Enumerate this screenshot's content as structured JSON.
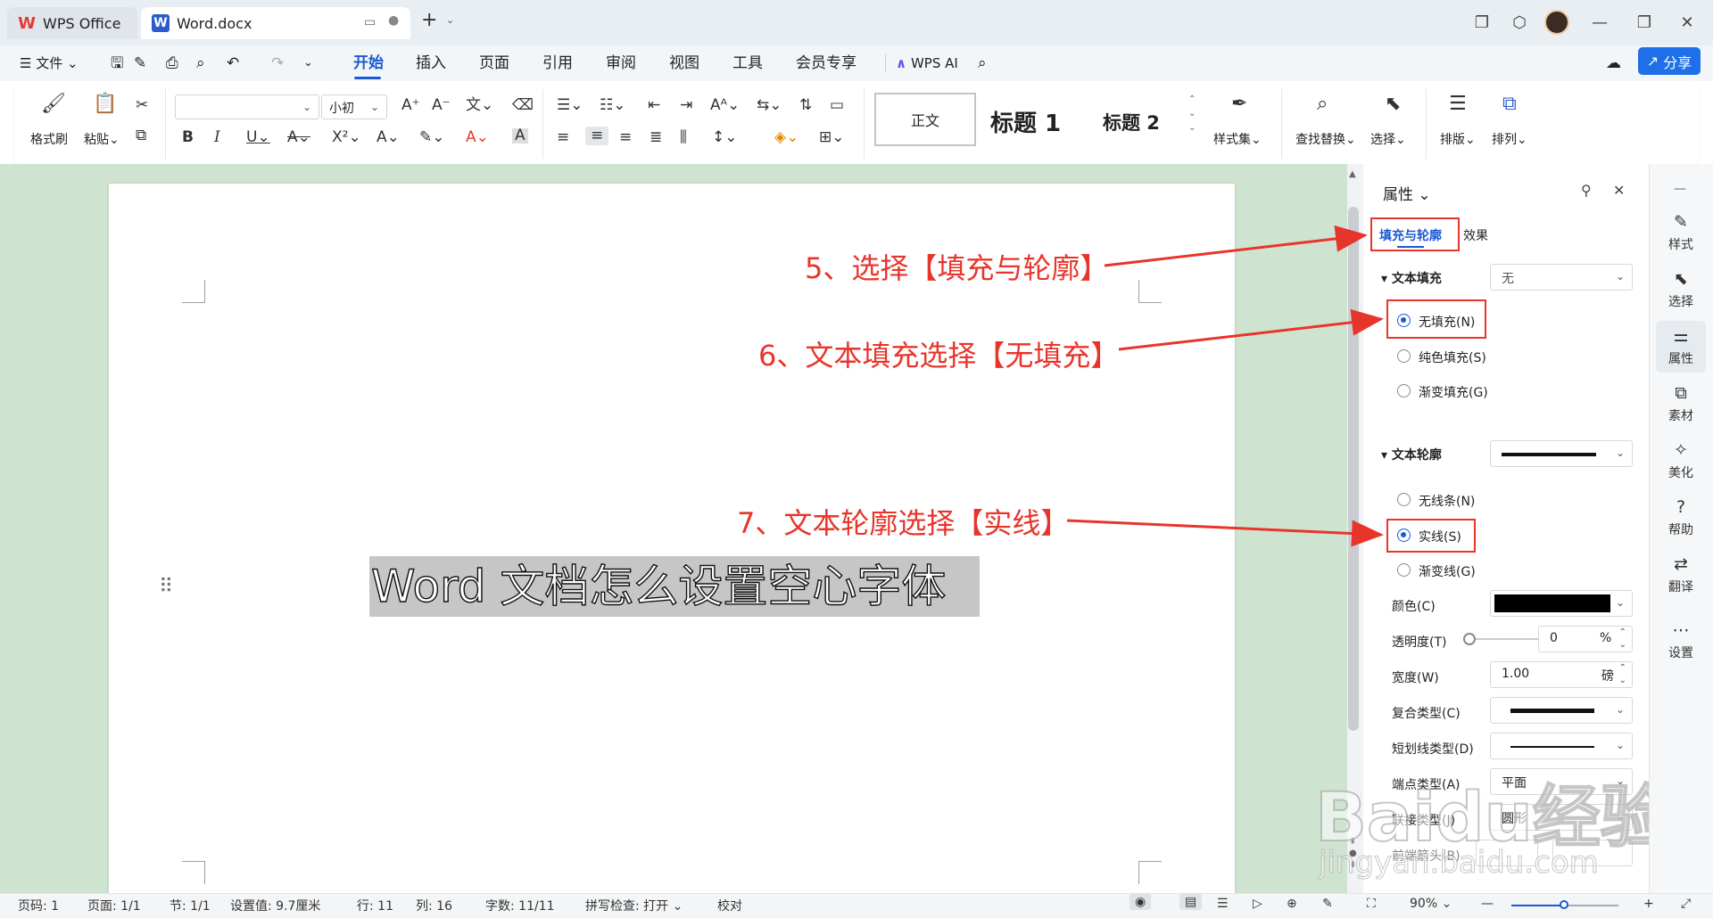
{
  "titlebar": {
    "tabs": [
      {
        "label": "WPS Office"
      },
      {
        "label": "Word.docx"
      }
    ]
  },
  "menu": {
    "file": "文件",
    "items": [
      "开始",
      "插入",
      "页面",
      "引用",
      "审阅",
      "视图",
      "工具",
      "会员专享"
    ],
    "wps_ai": "WPS AI",
    "share": "分享"
  },
  "ribbon": {
    "format_painter": "格式刷",
    "paste": "粘贴",
    "font_size": "小初",
    "font_name": "",
    "styles": {
      "normal": "正文",
      "heading1": "标题 1",
      "heading2": "标题 2"
    },
    "style_set": "样式集",
    "find_replace": "查找替换",
    "select": "选择",
    "typeset": "排版",
    "arrange": "排列"
  },
  "document": {
    "text": "Word 文档怎么设置空心字体"
  },
  "annotations": {
    "step5": "5、选择【填充与轮廓】",
    "step6": "6、文本填充选择【无填充】",
    "step7": "7、文本轮廓选择【实线】"
  },
  "panel": {
    "title": "属性",
    "tabs": {
      "fill_outline": "填充与轮廓",
      "effects": "效果"
    },
    "text_fill": {
      "title": "文本填充",
      "value": "无",
      "options": [
        "无填充(N)",
        "纯色填充(S)",
        "渐变填充(G)"
      ],
      "selected": 0
    },
    "text_outline": {
      "title": "文本轮廓",
      "options": [
        "无线条(N)",
        "实线(S)",
        "渐变线(G)"
      ],
      "selected": 1
    },
    "color_label": "颜色(C)",
    "color_value": "#000000",
    "transparency_label": "透明度(T)",
    "transparency_value": "0",
    "transparency_unit": "%",
    "width_label": "宽度(W)",
    "width_value": "1.00",
    "width_unit": "磅",
    "compound_label": "复合类型(C)",
    "dash_label": "短划线类型(D)",
    "cap_label": "端点类型(A)",
    "cap_value": "平面",
    "join_label": "联接类型(J)",
    "join_value": "圆形",
    "arrow_label": "前端箭头(B)"
  },
  "right_sidebar": [
    "样式",
    "选择",
    "属性",
    "素材",
    "美化",
    "帮助",
    "翻译",
    "设置"
  ],
  "statusbar": {
    "page_no": "页码: 1",
    "pages": "页面: 1/1",
    "section": "节: 1/1",
    "set_value": "设置值: 9.7厘米",
    "row": "行: 11",
    "col": "列: 16",
    "words": "字数: 11/11",
    "spell": "拼写检查: 打开",
    "proof": "校对",
    "zoom": "90%"
  },
  "watermark": {
    "line1": "Baidu经验",
    "line2": "jingyan.baidu.com"
  },
  "colors": {
    "accent": "#1a59d6",
    "annotation": "#e8352b",
    "workspace": "#cfe3d1"
  }
}
